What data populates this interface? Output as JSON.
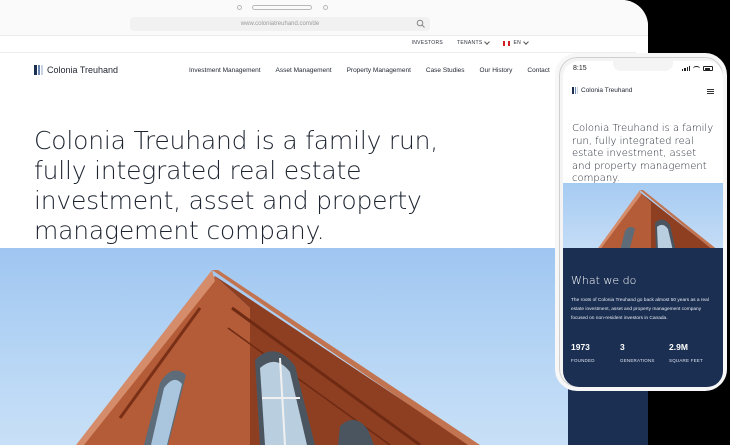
{
  "browser": {
    "url": "www.coloniatreuhand.com/de"
  },
  "utility_nav": {
    "investors": "INVESTORS",
    "tenants": "TENANTS",
    "language": "EN"
  },
  "brand": {
    "name": "Colonia Treuhand"
  },
  "main_nav": [
    "Investment Management",
    "Asset Management",
    "Property Management",
    "Case Studies",
    "Our History",
    "Contact"
  ],
  "hero": {
    "headline": "Colonia Treuhand is a family run, fully integrated real estate investment, asset and property management company."
  },
  "mobile": {
    "time": "8:15",
    "brand": "Colonia Treuhand",
    "headline": "Colonia Treuhand is a family run, fully integrated real estate investment, asset and property management company.",
    "section_title": "What we do",
    "section_body": "The roots of Colonia Treuhand go back almost 50 years as a real estate investment, asset and property management company focused on non-resident investors in Canada.",
    "stats": [
      {
        "value": "1973",
        "label": "FOUNDED"
      },
      {
        "value": "3",
        "label": "GENERATIONS"
      },
      {
        "value": "2.9M",
        "label": "SQUARE FEET"
      }
    ]
  },
  "colors": {
    "navy": "#1b2f52",
    "sky": "#a6cbf2",
    "brick": "#a8502f",
    "text": "#1d2430"
  },
  "icons": [
    "search-icon",
    "chevron-down-icon",
    "canada-flag-icon",
    "logo-mark-icon",
    "hamburger-menu-icon",
    "signal-icon",
    "wifi-icon",
    "battery-icon"
  ]
}
